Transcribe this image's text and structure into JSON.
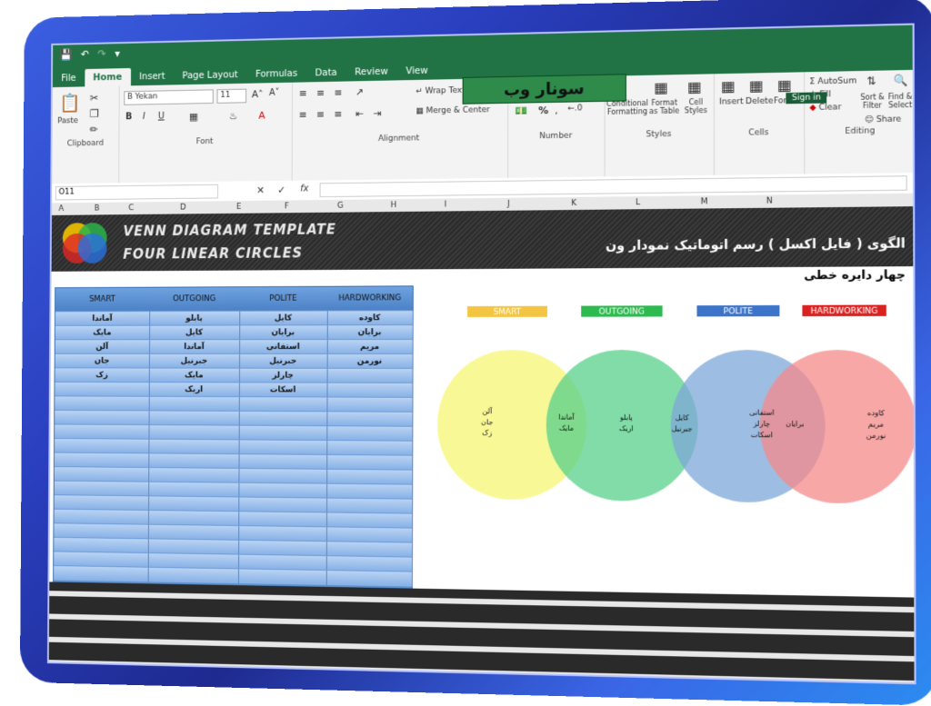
{
  "ribbon": {
    "tabs": [
      "File",
      "Home",
      "Insert",
      "Page Layout",
      "Formulas",
      "Data",
      "Review",
      "View"
    ],
    "active_tab": "Home",
    "brand": "سونار وب",
    "sign_in": "Sign in",
    "share": "Share",
    "clipboard": {
      "paste": "Paste",
      "label": "Clipboard"
    },
    "font": {
      "name": "B Yekan",
      "size": "11",
      "label": "Font"
    },
    "alignment": {
      "wrap": "Wrap Text",
      "merge": "Merge & Center",
      "label": "Alignment"
    },
    "number": {
      "label": "Number",
      "percent": "%"
    },
    "styles": {
      "conditional": "Conditional Formatting",
      "format_table": "Format as Table",
      "cell_styles": "Cell Styles",
      "label": "Styles"
    },
    "cells": {
      "insert": "Insert",
      "delete": "Delete",
      "format": "Format",
      "label": "Cells"
    },
    "editing": {
      "autosum": "AutoSum",
      "fill": "Fill",
      "clear": "Clear",
      "sort": "Sort & Filter",
      "find": "Find & Select",
      "label": "Editing"
    }
  },
  "formula_bar": {
    "name_box": "O11",
    "fx": "fx"
  },
  "columns": [
    "A",
    "B",
    "C",
    "D",
    "E",
    "F",
    "G",
    "H",
    "I",
    "J",
    "K",
    "L",
    "M",
    "N"
  ],
  "banner": {
    "title1": "VENN DIAGRAM TEMPLATE",
    "title2": "FOUR LINEAR CIRCLES",
    "fa_title": "الگوی ( فایل اکسل ) رسم اتوماتیک نمودار ون",
    "fa_sub": "چهار دایره خطی"
  },
  "table": {
    "headers": [
      "SMART",
      "OUTGOING",
      "POLITE",
      "HARDWORKING"
    ],
    "rows": [
      [
        "آماندا",
        "پابلو",
        "کایل",
        "کاوده"
      ],
      [
        "مایک",
        "کایل",
        "برایان",
        "برایان"
      ],
      [
        "آلن",
        "آماندا",
        "استفانی",
        "مریم"
      ],
      [
        "جان",
        "جبرنیل",
        "جبرنیل",
        "نورمن"
      ],
      [
        "زک",
        "مایک",
        "چارلز",
        ""
      ],
      [
        "",
        "اریک",
        "اسکات",
        ""
      ]
    ]
  },
  "venn": {
    "labels": [
      "SMART",
      "OUTGOING",
      "POLITE",
      "HARDWORKING"
    ],
    "colors": [
      "#f7f574",
      "#57d08a",
      "#7ea7d8",
      "#f58a8a"
    ],
    "label_colors": [
      "#f4c542",
      "#2dbb4f",
      "#3b74c9",
      "#d9221f"
    ],
    "regions": {
      "smart_only": [
        "آلن",
        "جان",
        "زک"
      ],
      "smart_outgoing": [
        "آماندا",
        "مایک"
      ],
      "outgoing_only": [
        "پابلو",
        "اریک"
      ],
      "outgoing_polite": [
        "کایل",
        "جبرنیل"
      ],
      "polite_only": [
        "استفانی",
        "چارلز",
        "اسکات"
      ],
      "polite_hardworking": [
        "برایان"
      ],
      "hardworking_only": [
        "کاوده",
        "مریم",
        "نورمن"
      ]
    }
  }
}
